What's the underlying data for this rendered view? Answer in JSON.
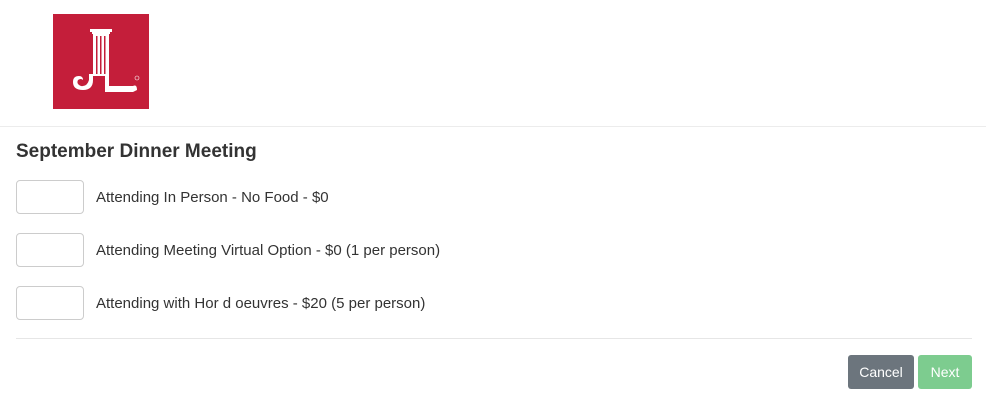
{
  "header": {
    "logo_icon": "junior-league-logo-icon",
    "logo_color": "#c41e3a"
  },
  "form": {
    "title": "September Dinner Meeting",
    "options": [
      {
        "label": "Attending In Person - No Food - $0",
        "value": ""
      },
      {
        "label": "Attending Meeting Virtual Option - $0 (1 per person)",
        "value": ""
      },
      {
        "label": "Attending with Hor d oeuvres - $20 (5 per person)",
        "value": ""
      }
    ]
  },
  "actions": {
    "cancel_label": "Cancel",
    "next_label": "Next",
    "cancel_color": "#6c757d",
    "next_color": "#7dcc8f"
  }
}
